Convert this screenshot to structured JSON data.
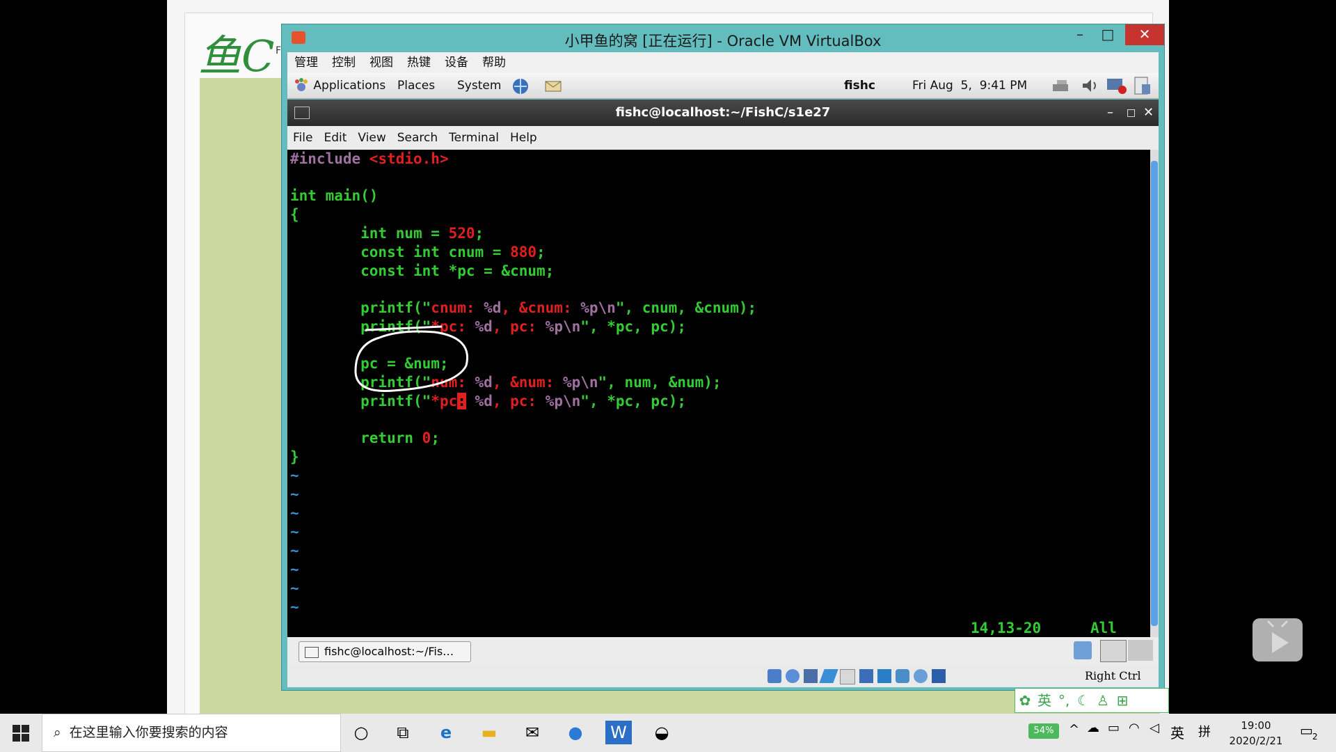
{
  "host": {
    "logo_text": "鱼C",
    "logo_side": "F"
  },
  "vbox": {
    "title": "小甲鱼的窝 [正在运行] - Oracle VM VirtualBox",
    "menu": [
      "管理",
      "控制",
      "视图",
      "热键",
      "设备",
      "帮助"
    ],
    "min_label": "–",
    "max_label": "□",
    "close_label": "✕",
    "host_key": "Right Ctrl"
  },
  "gnome_panel": {
    "applications": "Applications",
    "places": "Places",
    "system": "System",
    "user": "fishc",
    "datetime": "Fri Aug  5,  9:41 PM"
  },
  "terminal": {
    "title": "fishc@localhost:~/FishC/s1e27",
    "menu": [
      "File",
      "Edit",
      "View",
      "Search",
      "Terminal",
      "Help"
    ],
    "status_pos": "14,13-20",
    "status_all": "All",
    "task_label": "fishc@localhost:~/Fis…"
  },
  "code": {
    "l1a": "#include",
    "l1b": " <stdio.h>",
    "l3": "int main()",
    "l4": "{",
    "l5a": "        int num = ",
    "l5b": "520",
    "l5c": ";",
    "l6a": "        const int cnum = ",
    "l6b": "880",
    "l6c": ";",
    "l7": "        const int *pc = &cnum;",
    "l9a": "        printf(\"",
    "l9b": "cnum: ",
    "l9c": "%d",
    "l9d": ", &cnum: ",
    "l9e": "%p\\n",
    "l9f": "\", cnum, &cnum);",
    "l10a": "        printf(\"",
    "l10b": "*pc: ",
    "l10c": "%d",
    "l10d": ", pc: ",
    "l10e": "%p\\n",
    "l10f": "\", *pc, pc);",
    "l12": "        pc = &num;",
    "l13a": "        printf(\"",
    "l13b": "num: ",
    "l13c": "%d",
    "l13d": ", &num: ",
    "l13e": "%p\\n",
    "l13f": "\", num, &num);",
    "l14a": "        printf(\"",
    "l14b": "*pc",
    "l14cur": ":",
    "l14c": " ",
    "l14d": "%d",
    "l14e": ", pc: ",
    "l14f": "%p\\n",
    "l14g": "\", *pc, pc);",
    "l16a": "        return ",
    "l16b": "0",
    "l16c": ";",
    "l17": "}",
    "tilde": "~"
  },
  "ime": [
    "英",
    "°,",
    "☾"
  ],
  "taskbar": {
    "search_placeholder": "在这里输入你要搜索的内容",
    "battery": "54%",
    "lang": "英",
    "layout": "拼",
    "time": "19:00",
    "date": "2020/2/21",
    "notifications": "2"
  },
  "colors": {
    "accent": "#63bcbd",
    "code_green": "#33cc33",
    "code_red": "#e02020",
    "code_purple": "#a070a0"
  }
}
